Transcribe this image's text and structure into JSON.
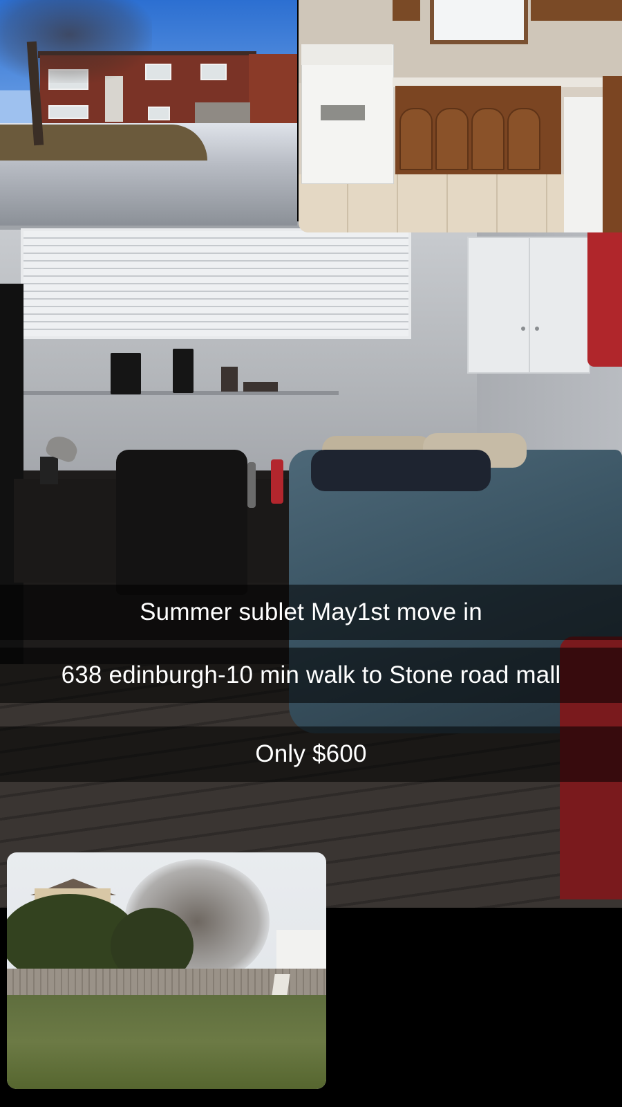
{
  "captions": {
    "line1": "Summer sublet May1st move in",
    "line2": "638 edinburgh-10 min walk to Stone road mall",
    "line3": "Only $600"
  },
  "photos": {
    "house": {
      "subject": "brick-house-exterior"
    },
    "kitchen": {
      "subject": "kitchen-with-stove"
    },
    "bedroom": {
      "subject": "bedroom-with-bed-and-desk"
    },
    "yard": {
      "subject": "backyard-lawn"
    }
  },
  "colors": {
    "background": "#000000",
    "caption_text": "#ffffff",
    "caption_strip": "rgba(0,0,0,0.55)"
  }
}
